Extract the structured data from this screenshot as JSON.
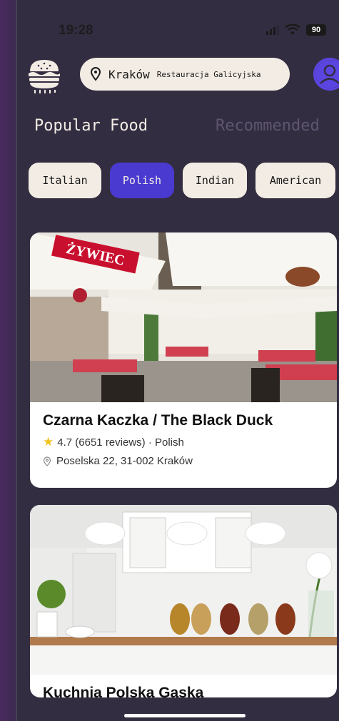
{
  "status": {
    "time": "19:28",
    "battery": "90"
  },
  "header": {
    "logo_icon": "burger-icon",
    "search": {
      "icon": "pin-icon",
      "city": "Kraków",
      "query": "Restauracja Galicyjska"
    },
    "avatar_icon": "user-icon"
  },
  "tabs": [
    {
      "label": "Popular Food",
      "active": true
    },
    {
      "label": "Recommended",
      "active": false
    }
  ],
  "categories": [
    {
      "label": "Italian",
      "selected": false
    },
    {
      "label": "Polish",
      "selected": true
    },
    {
      "label": "Indian",
      "selected": false
    },
    {
      "label": "American",
      "selected": false
    }
  ],
  "restaurants": [
    {
      "name": "Czarna Kaczka / The Black Duck",
      "rating": "4.7",
      "reviews": "(6651 reviews)",
      "cuisine": "Polish",
      "address": "Poselska 22, 31-002 Kraków",
      "sign_text": "ŻYWIEC"
    },
    {
      "name": "Kuchnia Polska Gąska"
    }
  ],
  "colors": {
    "accent": "#4a3ad0",
    "chip_bg": "#f3ece4",
    "background": "#332d41",
    "star": "#f2c31b"
  }
}
